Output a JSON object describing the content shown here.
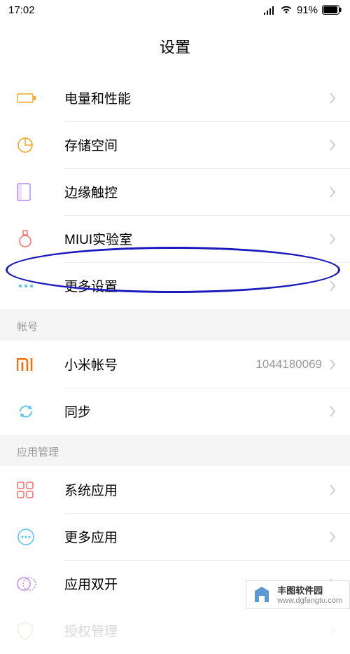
{
  "statusBar": {
    "time": "17:02",
    "batteryPercent": "91%"
  },
  "header": {
    "title": "设置"
  },
  "items": {
    "battery": {
      "label": "电量和性能"
    },
    "storage": {
      "label": "存储空间"
    },
    "edge": {
      "label": "边缘触控"
    },
    "lab": {
      "label": "MIUI实验室"
    },
    "more": {
      "label": "更多设置"
    }
  },
  "sections": {
    "account": {
      "header": "帐号"
    },
    "appMgmt": {
      "header": "应用管理"
    }
  },
  "account": {
    "miAccount": {
      "label": "小米帐号",
      "value": "1044180069"
    },
    "sync": {
      "label": "同步"
    }
  },
  "apps": {
    "system": {
      "label": "系统应用"
    },
    "more": {
      "label": "更多应用"
    },
    "dual": {
      "label": "应用双开"
    },
    "perm": {
      "label": "授权管理"
    }
  },
  "watermark": {
    "name": "丰图软件园",
    "url": "www.dgfengtu.com"
  }
}
